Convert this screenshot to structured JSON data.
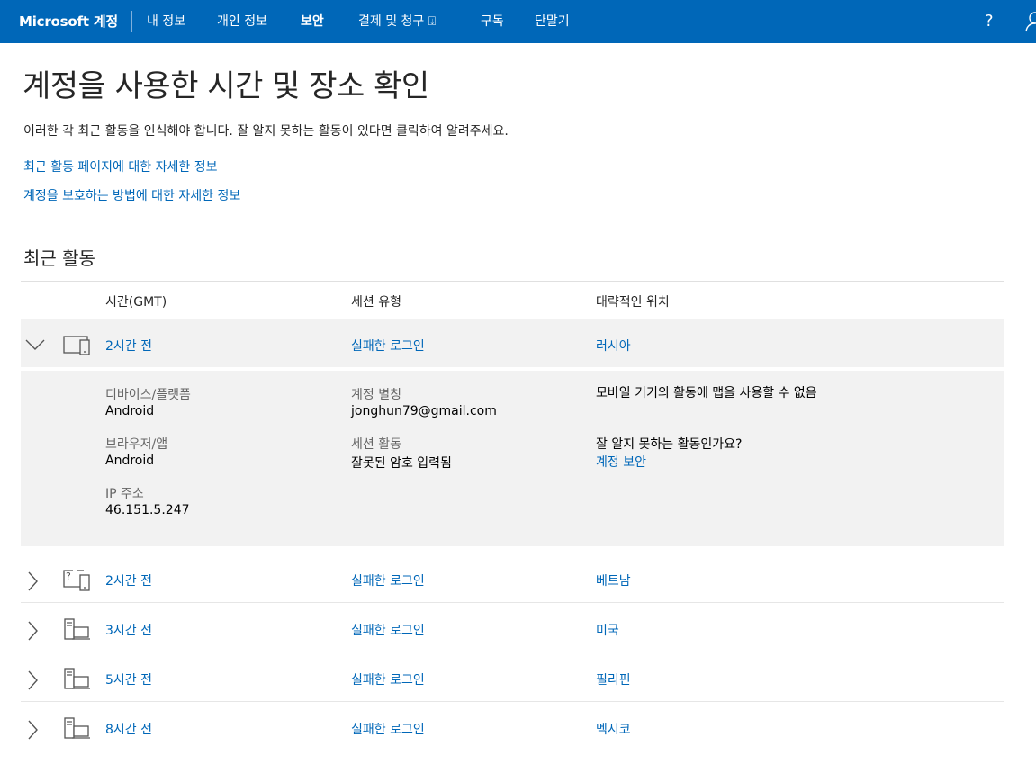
{
  "nav": {
    "brand": "Microsoft 계정",
    "items": [
      {
        "label": "내 정보"
      },
      {
        "label": "개인 정보"
      },
      {
        "label": "보안"
      },
      {
        "label": "결제 및 청구 ⍗"
      },
      {
        "label": "구독"
      },
      {
        "label": "단말기"
      }
    ],
    "help": "?"
  },
  "page": {
    "title": "계정을 사용한 시간 및 장소 확인",
    "intro": "이러한 각 최근 활동을 인식해야 합니다. 잘 알지 못하는 활동이 있다면 클릭하여 알려주세요.",
    "link_recent": "최근 활동 페이지에 대한 자세한 정보",
    "link_protect": "계정을 보호하는 방법에 대한 자세한 정보",
    "section_title": "최근 활동"
  },
  "table": {
    "headers": {
      "time": "시간(GMT)",
      "type": "세션 유형",
      "location": "대략적인 위치"
    },
    "expanded": {
      "time": "2시간 전",
      "type": "실패한 로그인",
      "location": "러시아",
      "device_label": "디바이스/플랫폼",
      "device_value": "Android",
      "browser_label": "브라우저/앱",
      "browser_value": "Android",
      "ip_label": "IP 주소",
      "ip_value": "46.151.5.247",
      "alias_label": "계정 별칭",
      "alias_value": "jonghun79@gmail.com",
      "session_label": "세션 활동",
      "session_value": "잘못된 암호 입력됨",
      "map_note": "모바일 기기의 활동에 맵을 사용할 수 없음",
      "unknown_q": "잘 알지 못하는 활동인가요?",
      "security_link": "계정 보안"
    },
    "rows": [
      {
        "time": "2시간 전",
        "type": "실패한 로그인",
        "location": "베트남",
        "icon": "unknown-device-icon"
      },
      {
        "time": "3시간 전",
        "type": "실패한 로그인",
        "location": "미국",
        "icon": "desktop-icon"
      },
      {
        "time": "5시간 전",
        "type": "실패한 로그인",
        "location": "필리핀",
        "icon": "desktop-icon"
      },
      {
        "time": "8시간 전",
        "type": "실패한 로그인",
        "location": "멕시코",
        "icon": "desktop-icon"
      }
    ]
  }
}
